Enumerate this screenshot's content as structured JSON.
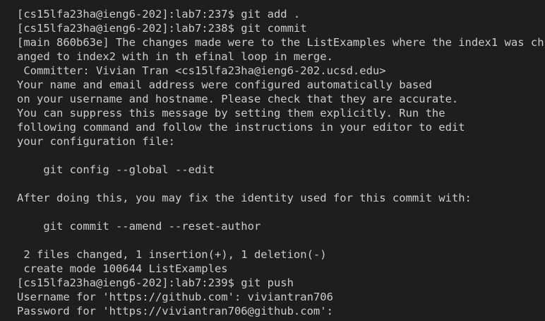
{
  "terminal": {
    "lines": [
      "[cs15lfa23ha@ieng6-202]:lab7:237$ git add .",
      "[cs15lfa23ha@ieng6-202]:lab7:238$ git commit",
      "[main 860b63e] The changes made were to the ListExamples where the index1 was ch",
      "anged to index2 with in th efinal loop in merge.",
      " Committer: Vivian Tran <cs15lfa23ha@ieng6-202.ucsd.edu>",
      "Your name and email address were configured automatically based",
      "on your username and hostname. Please check that they are accurate.",
      "You can suppress this message by setting them explicitly. Run the",
      "following command and follow the instructions in your editor to edit",
      "your configuration file:",
      "",
      "    git config --global --edit",
      "",
      "After doing this, you may fix the identity used for this commit with:",
      "",
      "    git commit --amend --reset-author",
      "",
      " 2 files changed, 1 insertion(+), 1 deletion(-)",
      " create mode 100644 ListExamples",
      "[cs15lfa23ha@ieng6-202]:lab7:239$ git push",
      "Username for 'https://github.com': viviantran706",
      "Password for 'https://viviantran706@github.com':"
    ]
  }
}
